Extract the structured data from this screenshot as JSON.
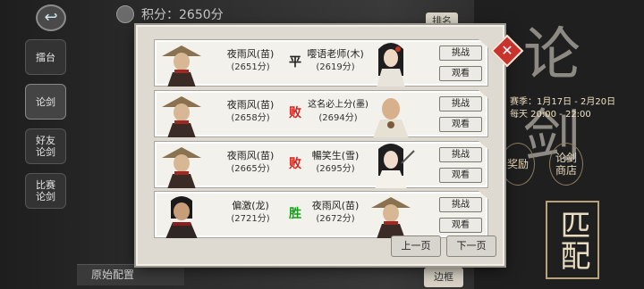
{
  "header": {
    "score_label": "积分：2650分",
    "rank_tag": "排名"
  },
  "side_nav": {
    "items": [
      "擂台",
      "论剑",
      "好友\n论剑",
      "比赛\n论剑"
    ]
  },
  "bottom": {
    "config_label": "原始配置",
    "edge_tag": "边框"
  },
  "right_panel": {
    "hero_title": "论剑",
    "season_line": "赛季：1月17日 - 2月20日",
    "time_line": "每天 20:00 - 22:00",
    "reward_btn": "奖励",
    "shop_btn": "论剑\n商店",
    "match_btn": "匹配"
  },
  "records": [
    {
      "left_name": "夜雨风(苗)",
      "left_pts": "(2651分)",
      "result": "平",
      "right_name": "嘤语老师(木)",
      "right_pts": "(2619分)",
      "btn1": "挑战",
      "btn2": "观看"
    },
    {
      "left_name": "夜雨风(苗)",
      "left_pts": "(2658分)",
      "result": "败",
      "right_name": "这名必上分(墨)",
      "right_pts": "(2694分)",
      "btn1": "挑战",
      "btn2": "观看"
    },
    {
      "left_name": "夜雨风(苗)",
      "left_pts": "(2665分)",
      "result": "败",
      "right_name": "暢笑生(雪)",
      "right_pts": "(2695分)",
      "btn1": "挑战",
      "btn2": "观看"
    },
    {
      "left_name": "偏激(龙)",
      "left_pts": "(2721分)",
      "result": "胜",
      "right_name": "夜雨风(苗)",
      "right_pts": "(2672分)",
      "btn1": "挑战",
      "btn2": "观看"
    }
  ],
  "pager": {
    "prev": "上一页",
    "next": "下一页"
  },
  "colors": {
    "draw": "#222222",
    "lose": "#d1231b",
    "win": "#13a01a",
    "close": "#c9332d"
  }
}
